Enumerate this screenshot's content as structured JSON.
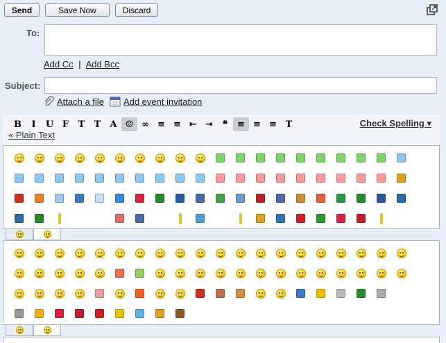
{
  "toolbar": {
    "send_label": "Send",
    "save_label": "Save Now",
    "discard_label": "Discard"
  },
  "compose": {
    "to_label": "To:",
    "to_value": "",
    "add_cc": "Add Cc",
    "separator": "|",
    "add_bcc": "Add Bcc",
    "subject_label": "Subject:",
    "subject_value": "",
    "attach_file": "Attach a file",
    "add_event": "Add event invitation"
  },
  "editor": {
    "check_spelling": "Check Spelling ▾",
    "plain_text": "« Plain Text",
    "icons": [
      "bold-icon",
      "italic-icon",
      "underline-icon",
      "font-icon",
      "font-size-icon",
      "text-color-icon",
      "highlight-color-icon",
      "insert-emoticon-icon",
      "link-icon",
      "numbered-list-icon",
      "bulleted-list-icon",
      "indent-less-icon",
      "indent-more-icon",
      "quote-icon",
      "align-left-icon",
      "align-center-icon",
      "align-right-icon",
      "remove-formatting-icon"
    ],
    "icon_glyphs": [
      "B",
      "I",
      "U",
      "F",
      "T",
      "T",
      "A",
      "☺",
      "∞",
      "≡",
      "≡",
      "⇤",
      "⇥",
      "❝",
      "≡",
      "≡",
      "≡",
      "T"
    ]
  },
  "emoticons_panel_1": {
    "rows": [
      [
        "smiley",
        "smiley",
        "smiley",
        "smiley",
        "smiley",
        "smiley",
        "smiley",
        "smiley",
        "smiley",
        "smiley",
        "green",
        "green",
        "green",
        "green",
        "green",
        "green",
        "green",
        "green",
        "green",
        "blue"
      ],
      [
        "blue",
        "blue",
        "blue",
        "blue",
        "blue",
        "blue",
        "blue",
        "blue",
        "blue",
        "blue",
        "red",
        "red",
        "red",
        "red",
        "red",
        "red",
        "red",
        "red",
        "red",
        "box"
      ],
      [
        "crab",
        "sun",
        "cloud",
        "umbrella",
        "snowman",
        "moon",
        "flower",
        "clover",
        "house",
        "camera",
        "gift",
        "syringe",
        "phone",
        "laptop",
        "briefcase",
        "clock",
        "car",
        "pin",
        "camera2",
        "note"
      ],
      [
        "music",
        "tv",
        "bar",
        "",
        "",
        "cake",
        "fork",
        "",
        "bar",
        "cocktail",
        "",
        "bar",
        "exclaim",
        "question",
        "exclaims",
        "question2",
        "heart",
        "broken-heart",
        "bar",
        "",
        "",
        "",
        "",
        "black-bar"
      ]
    ]
  },
  "emoticons_panel_2": {
    "rows": [
      [
        "smiley",
        "smiley",
        "smiley",
        "smiley",
        "smiley",
        "smiley",
        "smiley",
        "smiley",
        "smiley",
        "smiley",
        "smiley",
        "smiley",
        "smiley",
        "smiley",
        "smiley",
        "smiley",
        "smiley",
        "smiley",
        "smiley",
        "smiley"
      ],
      [
        "smiley",
        "smiley",
        "smiley",
        "smiley",
        "smiley",
        "red-smiley",
        "green-smiley",
        "smiley",
        "smiley",
        "smiley",
        "smiley",
        "smiley",
        "smiley",
        "smiley",
        "smiley",
        "smiley",
        "smiley",
        "smiley",
        "smiley",
        "smiley"
      ],
      [
        "smiley",
        "smiley",
        "smiley",
        "smiley",
        "pig",
        "smiley",
        "fire",
        "smiley",
        "smiley",
        "devil",
        "cow",
        "dog",
        "smiley",
        "smiley",
        "umbrella",
        "lightning",
        "wheel",
        "clover",
        "cup"
      ],
      [
        "martini",
        "beer",
        "heart",
        "rose",
        "stop",
        "candle",
        "drop",
        "crown",
        "poop"
      ]
    ]
  },
  "colors": {
    "background": "#e8eef7",
    "border": "#a9b7c9"
  }
}
